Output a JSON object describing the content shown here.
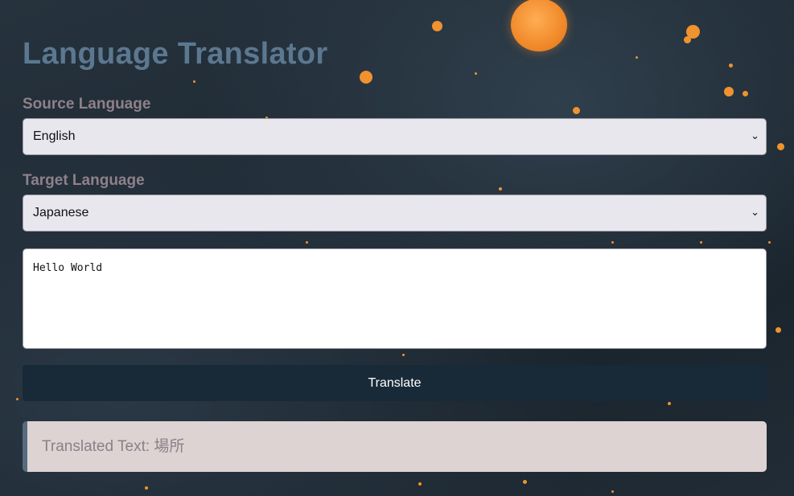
{
  "app": {
    "title": "Language Translator"
  },
  "source": {
    "label": "Source Language",
    "selected": "English"
  },
  "target": {
    "label": "Target Language",
    "selected": "Japanese"
  },
  "input": {
    "value": "Hello World"
  },
  "translate_button": {
    "label": "Translate"
  },
  "result": {
    "prefix": "Translated Text: ",
    "text": "場所"
  },
  "icons": {
    "dropdown": "chevron-down-icon",
    "decoration": "moon-icon"
  },
  "colors": {
    "title": "#5b7890",
    "label": "#8e8189",
    "button": "#182a38",
    "result_bg": "#ddd3d3",
    "accent_border": "#566b7d",
    "moon": "#f08a2a"
  }
}
